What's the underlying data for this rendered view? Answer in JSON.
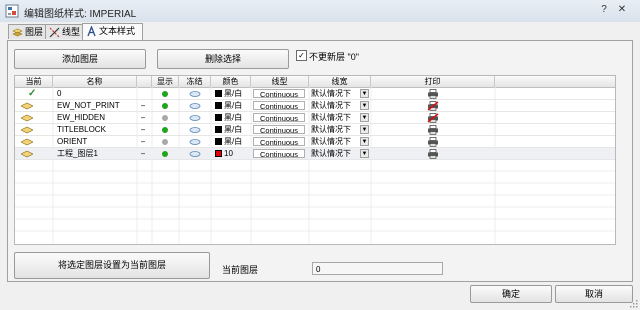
{
  "window": {
    "title": "编辑图纸样式: IMPERIAL",
    "controls": {
      "help": "?",
      "close": "✕"
    }
  },
  "tabs": [
    {
      "label": "图层",
      "icon": "layers-icon",
      "active": false
    },
    {
      "label": "线型",
      "icon": "linetype-icon",
      "active": false
    },
    {
      "label": "文本样式",
      "icon": "text-style-icon",
      "active": true
    }
  ],
  "toolbar": {
    "add_layer": "添加图层",
    "delete_selection": "删除选择",
    "no_update_checkbox": {
      "label": "不更新层 \"0\"",
      "checked": true
    }
  },
  "table": {
    "columns": [
      "当前",
      "名称",
      "显示",
      "冻结",
      "颜色",
      "线型",
      "线宽",
      "打印"
    ],
    "rows": [
      {
        "current": true,
        "name": "0",
        "dash": "",
        "visible": "green",
        "color_name": "黑/白",
        "color": "#000000",
        "linetype": "Continuous",
        "lineweight": "默认情况下",
        "print": true,
        "selected": false
      },
      {
        "current": false,
        "name": "EW_NOT_PRINT",
        "dash": "–",
        "visible": "green",
        "color_name": "黑/白",
        "color": "#000000",
        "linetype": "Continuous",
        "lineweight": "默认情况下",
        "print": false,
        "selected": false
      },
      {
        "current": false,
        "name": "EW_HIDDEN",
        "dash": "–",
        "visible": "grey",
        "color_name": "黑/白",
        "color": "#000000",
        "linetype": "Continuous",
        "lineweight": "默认情况下",
        "print": false,
        "selected": false
      },
      {
        "current": false,
        "name": "TITLEBLOCK",
        "dash": "–",
        "visible": "green",
        "color_name": "黑/白",
        "color": "#000000",
        "linetype": "Continuous",
        "lineweight": "默认情况下",
        "print": true,
        "selected": false
      },
      {
        "current": false,
        "name": "ORIENT",
        "dash": "–",
        "visible": "grey",
        "color_name": "黑/白",
        "color": "#000000",
        "linetype": "Continuous",
        "lineweight": "默认情况下",
        "print": true,
        "selected": false
      },
      {
        "current": false,
        "name": "工程_图层1",
        "dash": "–",
        "visible": "green",
        "color_name": "10",
        "color": "#e00000",
        "linetype": "Continuous",
        "lineweight": "默认情况下",
        "print": true,
        "selected": true
      }
    ]
  },
  "set_current_button": "将选定图层设置为当前图层",
  "current_layer": {
    "label": "当前图层",
    "value": "0"
  },
  "footer": {
    "ok": "确定",
    "cancel": "取消"
  }
}
